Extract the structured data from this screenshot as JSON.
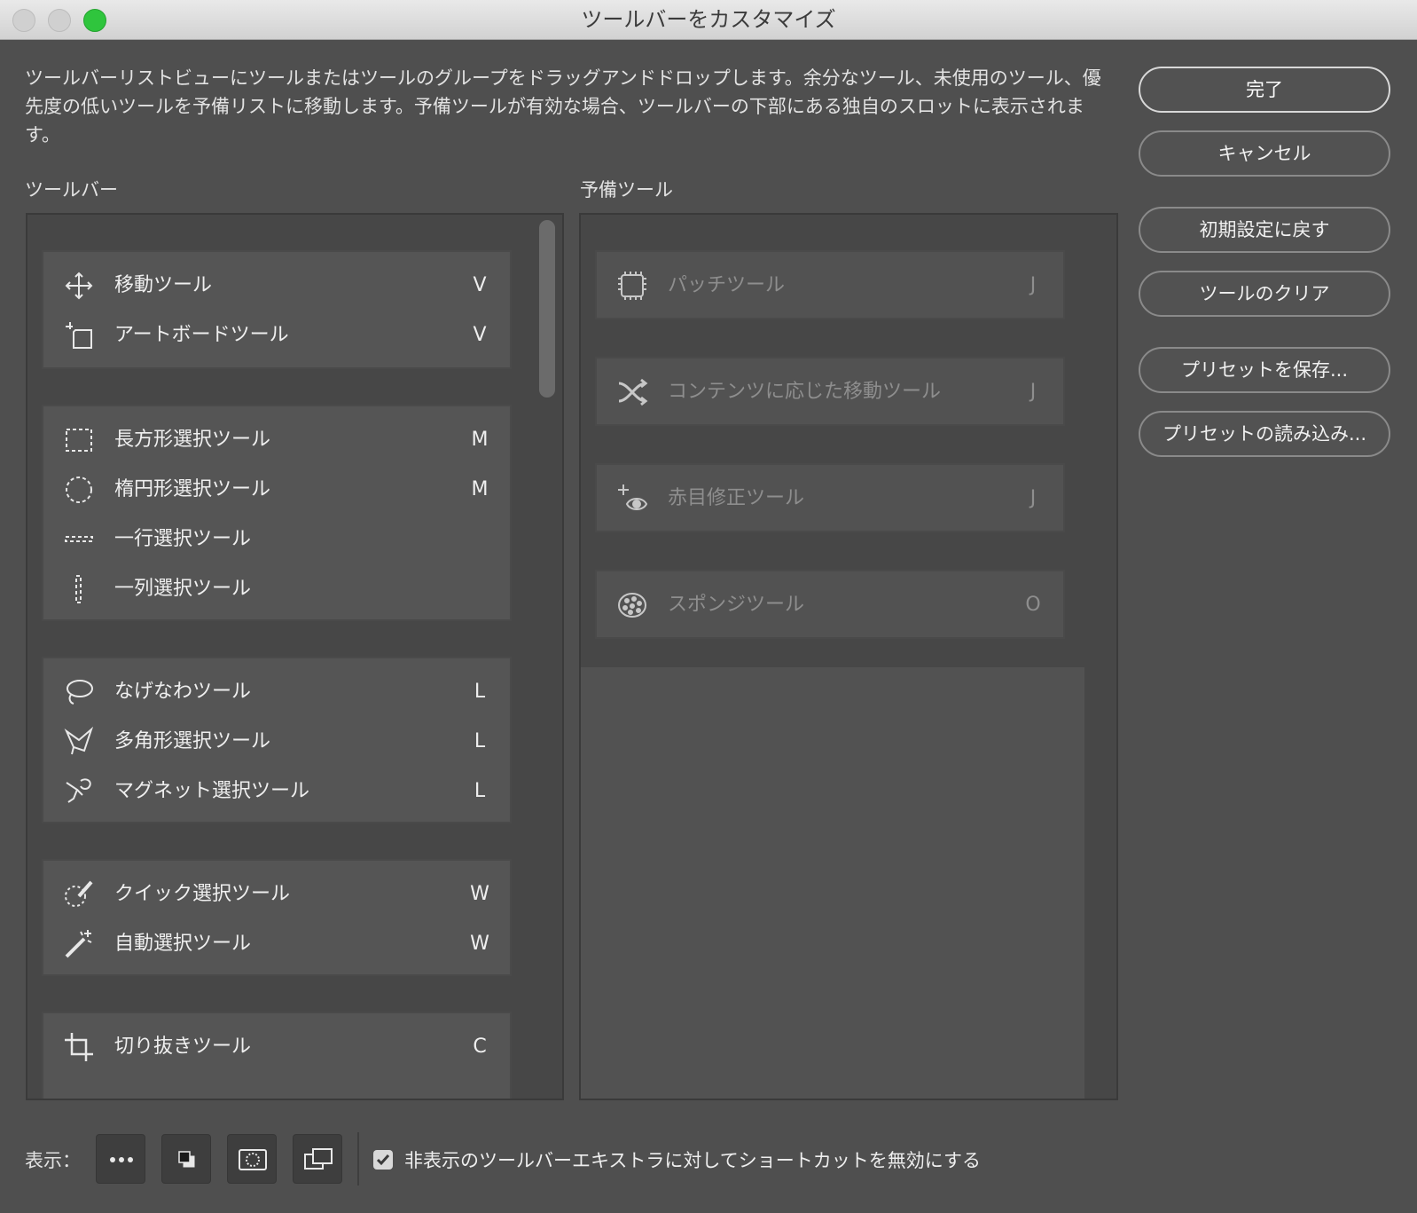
{
  "window": {
    "title": "ツールバーをカスタマイズ"
  },
  "description": "ツールバーリストビューにツールまたはツールのグループをドラッグアンドドロップします。余分なツール、未使用のツール、優先度の低いツールを予備リストに移動します。予備ツールが有効な場合、ツールバーの下部にある独自のスロットに表示されます。",
  "toolbar_list": {
    "label": "ツールバー",
    "groups": [
      {
        "tools": [
          {
            "name": "移動ツール",
            "key": "V",
            "icon": "move-icon"
          },
          {
            "name": "アートボードツール",
            "key": "V",
            "icon": "artboard-icon"
          }
        ]
      },
      {
        "tools": [
          {
            "name": "長方形選択ツール",
            "key": "M",
            "icon": "rectangular-marquee-icon"
          },
          {
            "name": "楕円形選択ツール",
            "key": "M",
            "icon": "elliptical-marquee-icon"
          },
          {
            "name": "一行選択ツール",
            "key": "",
            "icon": "single-row-marquee-icon"
          },
          {
            "name": "一列選択ツール",
            "key": "",
            "icon": "single-column-marquee-icon"
          }
        ]
      },
      {
        "tools": [
          {
            "name": "なげなわツール",
            "key": "L",
            "icon": "lasso-icon"
          },
          {
            "name": "多角形選択ツール",
            "key": "L",
            "icon": "polygonal-lasso-icon"
          },
          {
            "name": "マグネット選択ツール",
            "key": "L",
            "icon": "magnetic-lasso-icon"
          }
        ]
      },
      {
        "tools": [
          {
            "name": "クイック選択ツール",
            "key": "W",
            "icon": "quick-selection-icon"
          },
          {
            "name": "自動選択ツール",
            "key": "W",
            "icon": "magic-wand-icon"
          }
        ]
      },
      {
        "tools": [
          {
            "name": "切り抜きツール",
            "key": "C",
            "icon": "crop-icon"
          }
        ]
      }
    ]
  },
  "extra_tools": {
    "label": "予備ツール",
    "tools": [
      {
        "name": "パッチツール",
        "key": "J",
        "icon": "patch-icon"
      },
      {
        "name": "コンテンツに応じた移動ツール",
        "key": "J",
        "icon": "content-aware-move-icon"
      },
      {
        "name": "赤目修正ツール",
        "key": "J",
        "icon": "red-eye-icon"
      },
      {
        "name": "スポンジツール",
        "key": "O",
        "icon": "sponge-icon"
      }
    ]
  },
  "buttons": {
    "done": "完了",
    "cancel": "キャンセル",
    "restore_defaults": "初期設定に戻す",
    "clear_tools": "ツールのクリア",
    "save_preset": "プリセットを保存...",
    "load_preset": "プリセットの読み込み..."
  },
  "bottom": {
    "show_label": "表示：",
    "view_buttons": [
      "more-options-icon",
      "default-colors-icon",
      "quick-mask-icon",
      "screen-mode-icon"
    ],
    "checkbox_checked": true,
    "checkbox_label": "非表示のツールバーエキストラに対してショートカットを無効にする"
  },
  "colors": {
    "background": "#4f4f4f",
    "panel": "#474747",
    "group": "#555555",
    "text": "#efefef",
    "disabled_text": "#8e8e8e",
    "maximize_button": "#2fc53d"
  }
}
